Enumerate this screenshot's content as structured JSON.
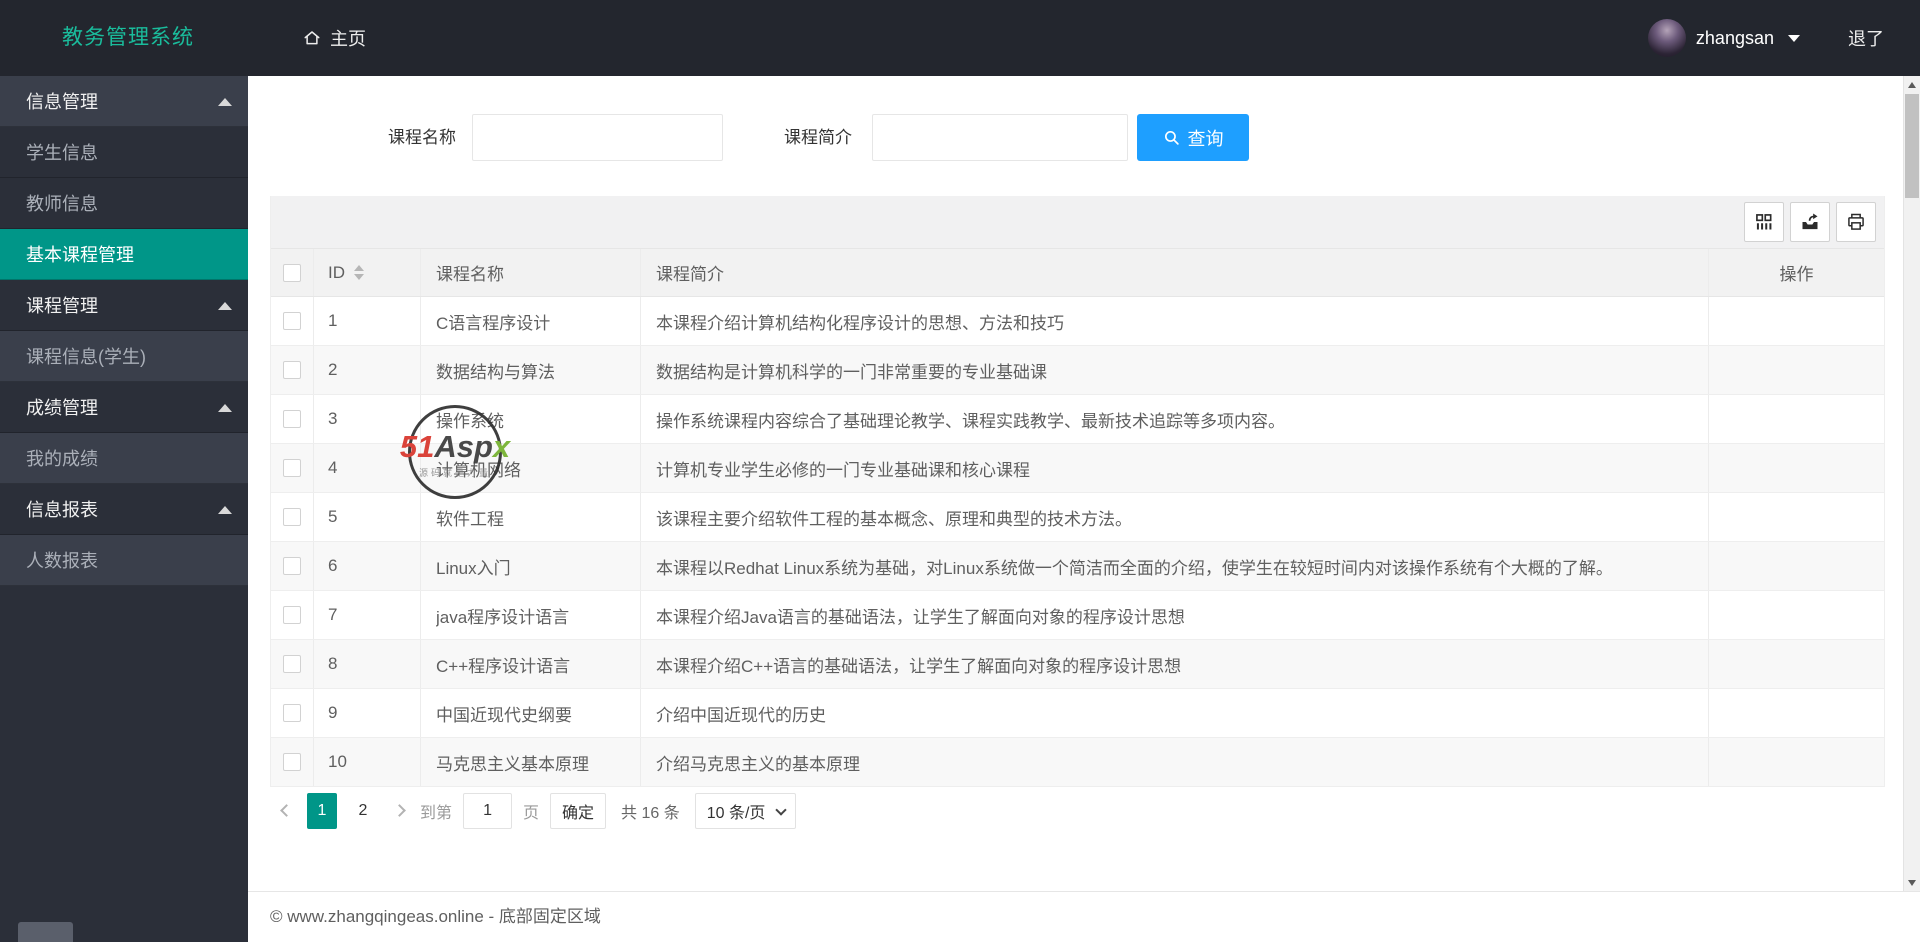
{
  "navbar": {
    "title": "教务管理系统",
    "home": "主页",
    "username": "zhangsan",
    "logout": "退了"
  },
  "sidebar": {
    "groups": [
      {
        "label": "信息管理",
        "expanded": true,
        "shade": "light",
        "items": [
          {
            "label": "学生信息",
            "shade": "dark"
          },
          {
            "label": "教师信息",
            "shade": "dark"
          },
          {
            "label": "基本课程管理",
            "shade": "dark",
            "active": true
          }
        ]
      },
      {
        "label": "课程管理",
        "expanded": true,
        "shade": "dark",
        "items": [
          {
            "label": "课程信息(学生)",
            "shade": "light"
          }
        ]
      },
      {
        "label": "成绩管理",
        "expanded": true,
        "shade": "dark",
        "items": [
          {
            "label": "我的成绩",
            "shade": "light"
          }
        ]
      },
      {
        "label": "信息报表",
        "expanded": true,
        "shade": "dark",
        "items": [
          {
            "label": "人数报表",
            "shade": "light"
          }
        ]
      }
    ]
  },
  "search": {
    "name_label": "课程名称",
    "name_value": "",
    "intro_label": "课程简介",
    "intro_value": "",
    "query_label": "查询"
  },
  "toolbar": {
    "icons": [
      "columns-icon",
      "export-icon",
      "print-icon"
    ]
  },
  "table": {
    "columns": [
      "ID",
      "课程名称",
      "课程简介",
      "操作"
    ],
    "rows": [
      {
        "id": "1",
        "name": "C语言程序设计",
        "intro": "本课程介绍计算机结构化程序设计的思想、方法和技巧"
      },
      {
        "id": "2",
        "name": "数据结构与算法",
        "intro": "数据结构是计算机科学的一门非常重要的专业基础课"
      },
      {
        "id": "3",
        "name": "操作系统",
        "intro": "操作系统课程内容综合了基础理论教学、课程实践教学、最新技术追踪等多项内容。"
      },
      {
        "id": "4",
        "name": "计算机网络",
        "intro": "计算机专业学生必修的一门专业基础课和核心课程"
      },
      {
        "id": "5",
        "name": "软件工程",
        "intro": "该课程主要介绍软件工程的基本概念、原理和典型的技术方法。"
      },
      {
        "id": "6",
        "name": "Linux入门",
        "intro": "本课程以Redhat Linux系统为基础，对Linux系统做一个简洁而全面的介绍，使学生在较短时间内对该操作系统有个大概的了解。"
      },
      {
        "id": "7",
        "name": "java程序设计语言",
        "intro": "本课程介绍Java语言的基础语法，让学生了解面向对象的程序设计思想"
      },
      {
        "id": "8",
        "name": "C++程序设计语言",
        "intro": "本课程介绍C++语言的基础语法，让学生了解面向对象的程序设计思想"
      },
      {
        "id": "9",
        "name": "中国近现代史纲要",
        "intro": "介绍中国近现代的历史"
      },
      {
        "id": "10",
        "name": "马克思主义基本原理",
        "intro": "介绍马克思主义的基本原理"
      }
    ]
  },
  "pagination": {
    "pages": [
      {
        "label": "1",
        "active": true
      },
      {
        "label": "2",
        "active": false
      }
    ],
    "jump_prefix": "到第",
    "jump_value": "1",
    "jump_suffix": "页",
    "confirm_label": "确定",
    "total_label": "共 16 条",
    "page_size_label": "10 条/页"
  },
  "watermark": {
    "brand_red": "51",
    "brand_dark": "Asp",
    "brand_green": "x",
    "tagline": "源码就是力量"
  },
  "footer": {
    "copyright": "© www.zhangqingeas.online - 底部固定区域"
  },
  "colors": {
    "brand": "#1abc9c",
    "active_menu": "#009688",
    "primary_button": "#1e9fff",
    "navbar_bg": "#23262e",
    "sidebar_bg": "#2b2f39"
  }
}
